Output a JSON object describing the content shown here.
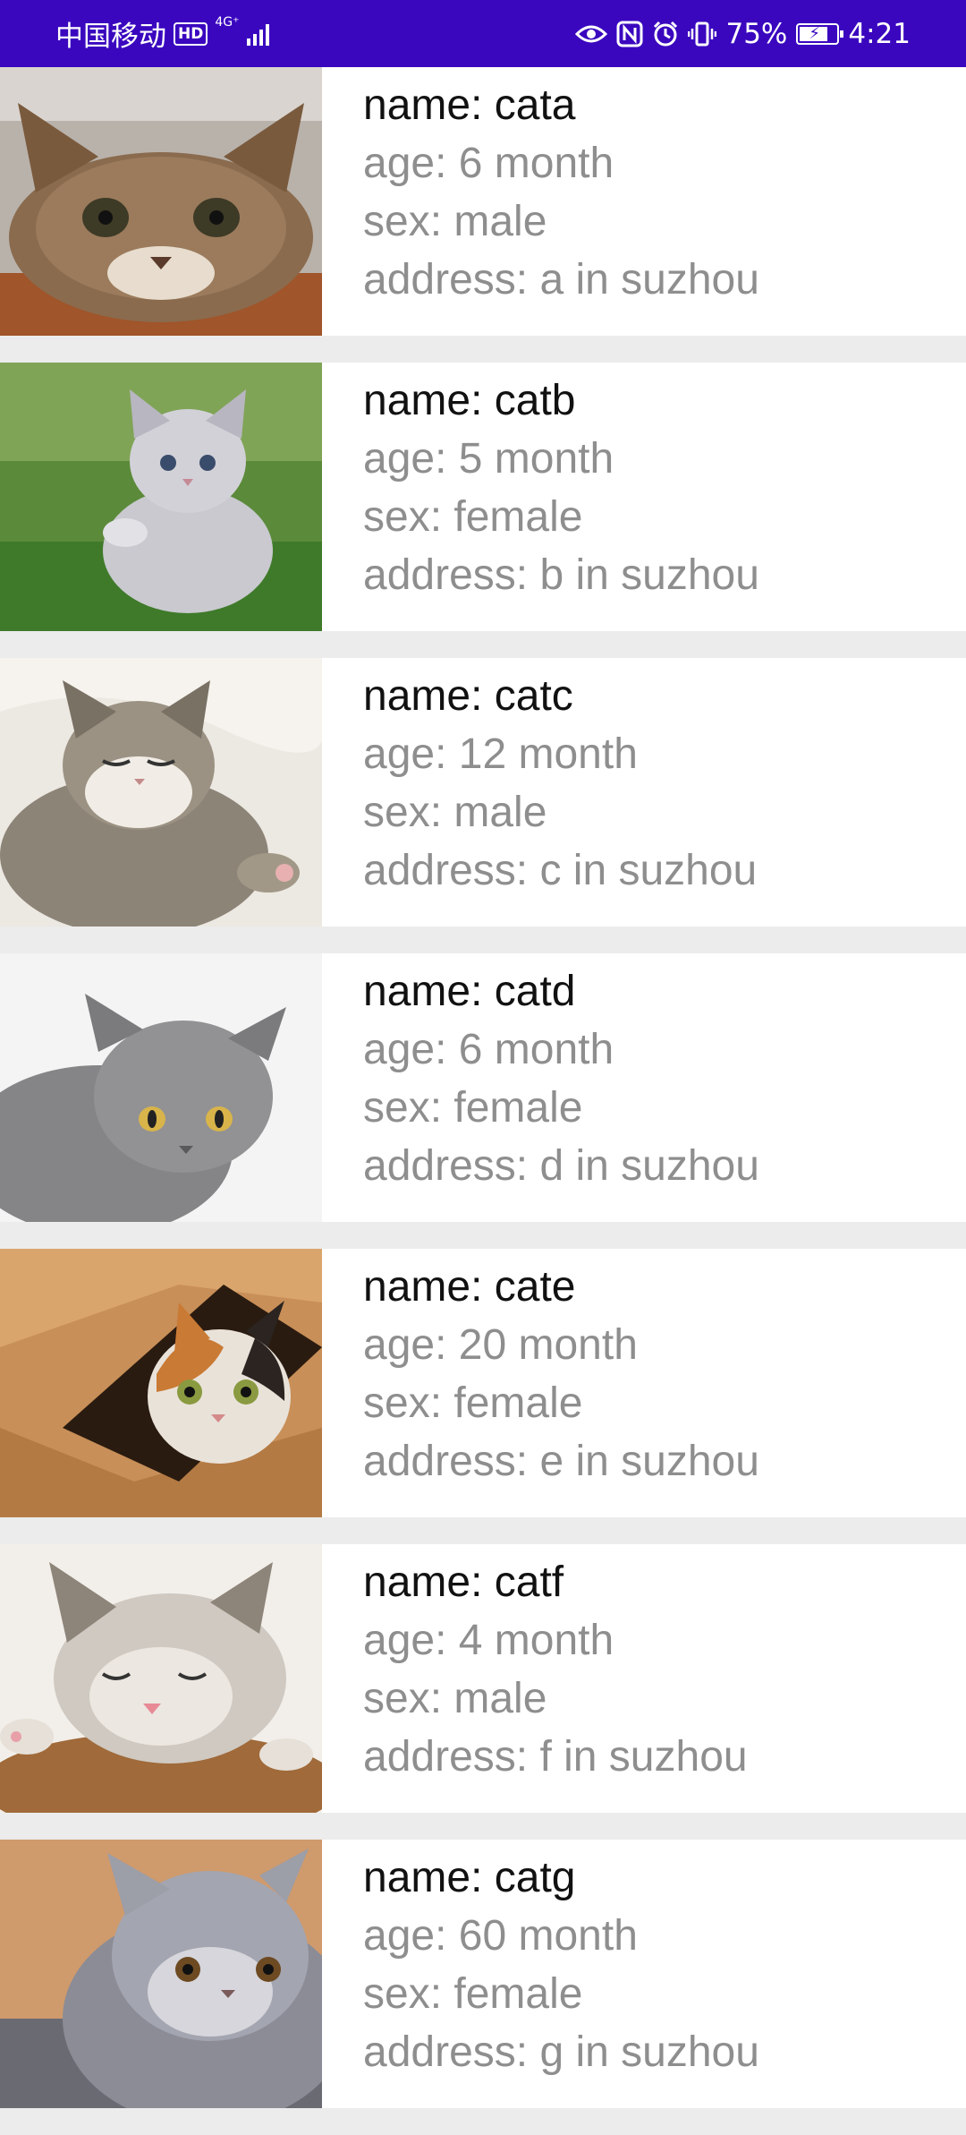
{
  "status_bar": {
    "carrier": "中国移动",
    "hd": "HD",
    "network": "4G⁺",
    "battery_percent": "75%",
    "time": "4:21",
    "icons": [
      "eye-icon",
      "nfc-icon",
      "alarm-icon",
      "vibrate-icon",
      "battery-icon"
    ]
  },
  "cats": [
    {
      "name": "name: cata",
      "age": "age: 6 month",
      "sex": "sex: male",
      "address": "address: a in suzhou",
      "photo": "tabby-cat-on-table"
    },
    {
      "name": "name: catb",
      "age": "age: 5 month",
      "sex": "sex: female",
      "address": "address: b in suzhou",
      "photo": "grey-kitten-on-grass"
    },
    {
      "name": "name: catc",
      "age": "age: 12 month",
      "sex": "sex: male",
      "address": "address: c in suzhou",
      "photo": "sleepy-tabby-kitten-on-blanket"
    },
    {
      "name": "name: catd",
      "age": "age: 6 month",
      "sex": "sex: female",
      "address": "address: d in suzhou",
      "photo": "grey-british-shorthair"
    },
    {
      "name": "name: cate",
      "age": "age: 20 month",
      "sex": "sex: female",
      "address": "address: e in suzhou",
      "photo": "calico-cat-in-box"
    },
    {
      "name": "name: catf",
      "age": "age: 4 month",
      "sex": "sex: male",
      "address": "address: f in suzhou",
      "photo": "sleeping-kitten-on-cushion"
    },
    {
      "name": "name: catg",
      "age": "age: 60 month",
      "sex": "sex: female",
      "address": "address: g in suzhou",
      "photo": "fluffy-persian-cat"
    }
  ],
  "colors": {
    "status_bar_bg": "#3a07bf",
    "name_text": "#111111",
    "detail_text": "#8e8e8e",
    "divider": "#ececec"
  }
}
